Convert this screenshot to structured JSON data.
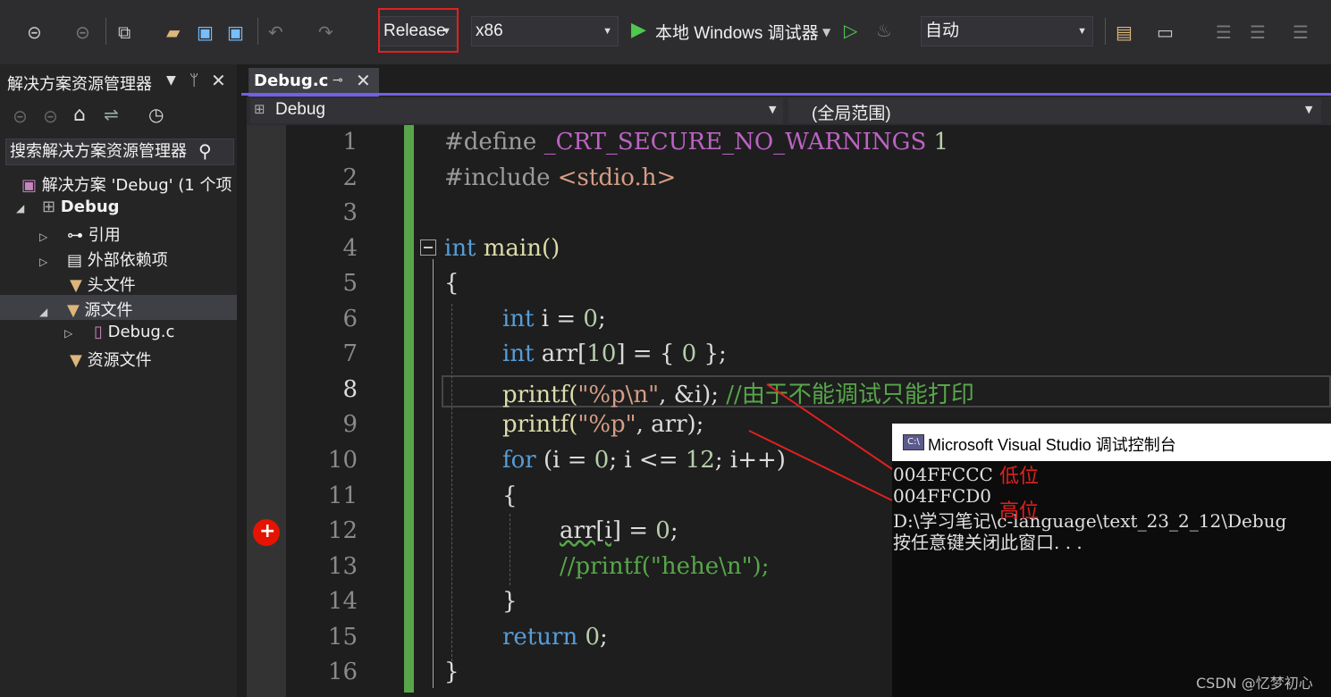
{
  "toolbar": {
    "config": "Release",
    "platform": "x86",
    "run_label": "本地 Windows 调试器",
    "mode": "自动"
  },
  "solution_explorer": {
    "title": "解决方案资源管理器",
    "search": "搜索解决方案资源管理器",
    "solution": "解决方案 'Debug' (1 个项",
    "project": "Debug",
    "items": {
      "refs": "引用",
      "external": "外部依赖项",
      "headers": "头文件",
      "sources": "源文件",
      "file": "Debug.c",
      "resources": "资源文件"
    }
  },
  "editor": {
    "tab": "Debug.c",
    "nav_left": "Debug",
    "nav_right": "(全局范围)",
    "current_line": 8,
    "breakpoint_line": 12,
    "line_numbers": [
      "1",
      "2",
      "3",
      "4",
      "5",
      "6",
      "7",
      "8",
      "9",
      "10",
      "11",
      "12",
      "13",
      "14",
      "15",
      "16"
    ]
  },
  "code": {
    "l1a": "#define ",
    "l1b": "_CRT_SECURE_NO_WARNINGS ",
    "l1c": "1",
    "l2a": "#include ",
    "l2b": "<stdio.h>",
    "l4a": "int",
    "l4b": " main()",
    "l5": "{",
    "l6a": "int",
    "l6b": " i = ",
    "l6c": "0",
    "l6d": ";",
    "l7a": "int",
    "l7b": " arr[",
    "l7c": "10",
    "l7d": "] = { ",
    "l7e": "0",
    "l7f": " };",
    "l8a": "printf(",
    "l8b": "\"%p\\n\"",
    "l8c": ", &i); ",
    "l8d": "//由于不能调试只能打印",
    "l9a": "printf(",
    "l9b": "\"%p\"",
    "l9c": ", arr);",
    "l10a": "for",
    "l10b": " (i = ",
    "l10c": "0",
    "l10d": "; i <= ",
    "l10e": "12",
    "l10f": "; i++)",
    "l11": "{",
    "l12a": "arr[i]",
    "l12b": " = ",
    "l12c": "0",
    "l12d": ";",
    "l13": "//printf(\"hehe\\n\");",
    "l14": "}",
    "l15a": "return",
    "l15b": " ",
    "l15c": "0",
    "l15d": ";",
    "l16": "}"
  },
  "console": {
    "title": "Microsoft Visual Studio 调试控制台",
    "icon": "C:\\",
    "lines": [
      "004FFCCC",
      "004FFCD0",
      "D:\\学习笔记\\c-language\\text_23_2_12\\Debug",
      "按任意键关闭此窗口. . ."
    ],
    "anno_low": "低位",
    "anno_high": "高位"
  },
  "watermark": "CSDN @忆梦初心",
  "colors": {
    "accent": "#7160e8",
    "highlight_box": "#e32020",
    "change_bar": "#57a64a",
    "breakpoint": "#e51400"
  }
}
